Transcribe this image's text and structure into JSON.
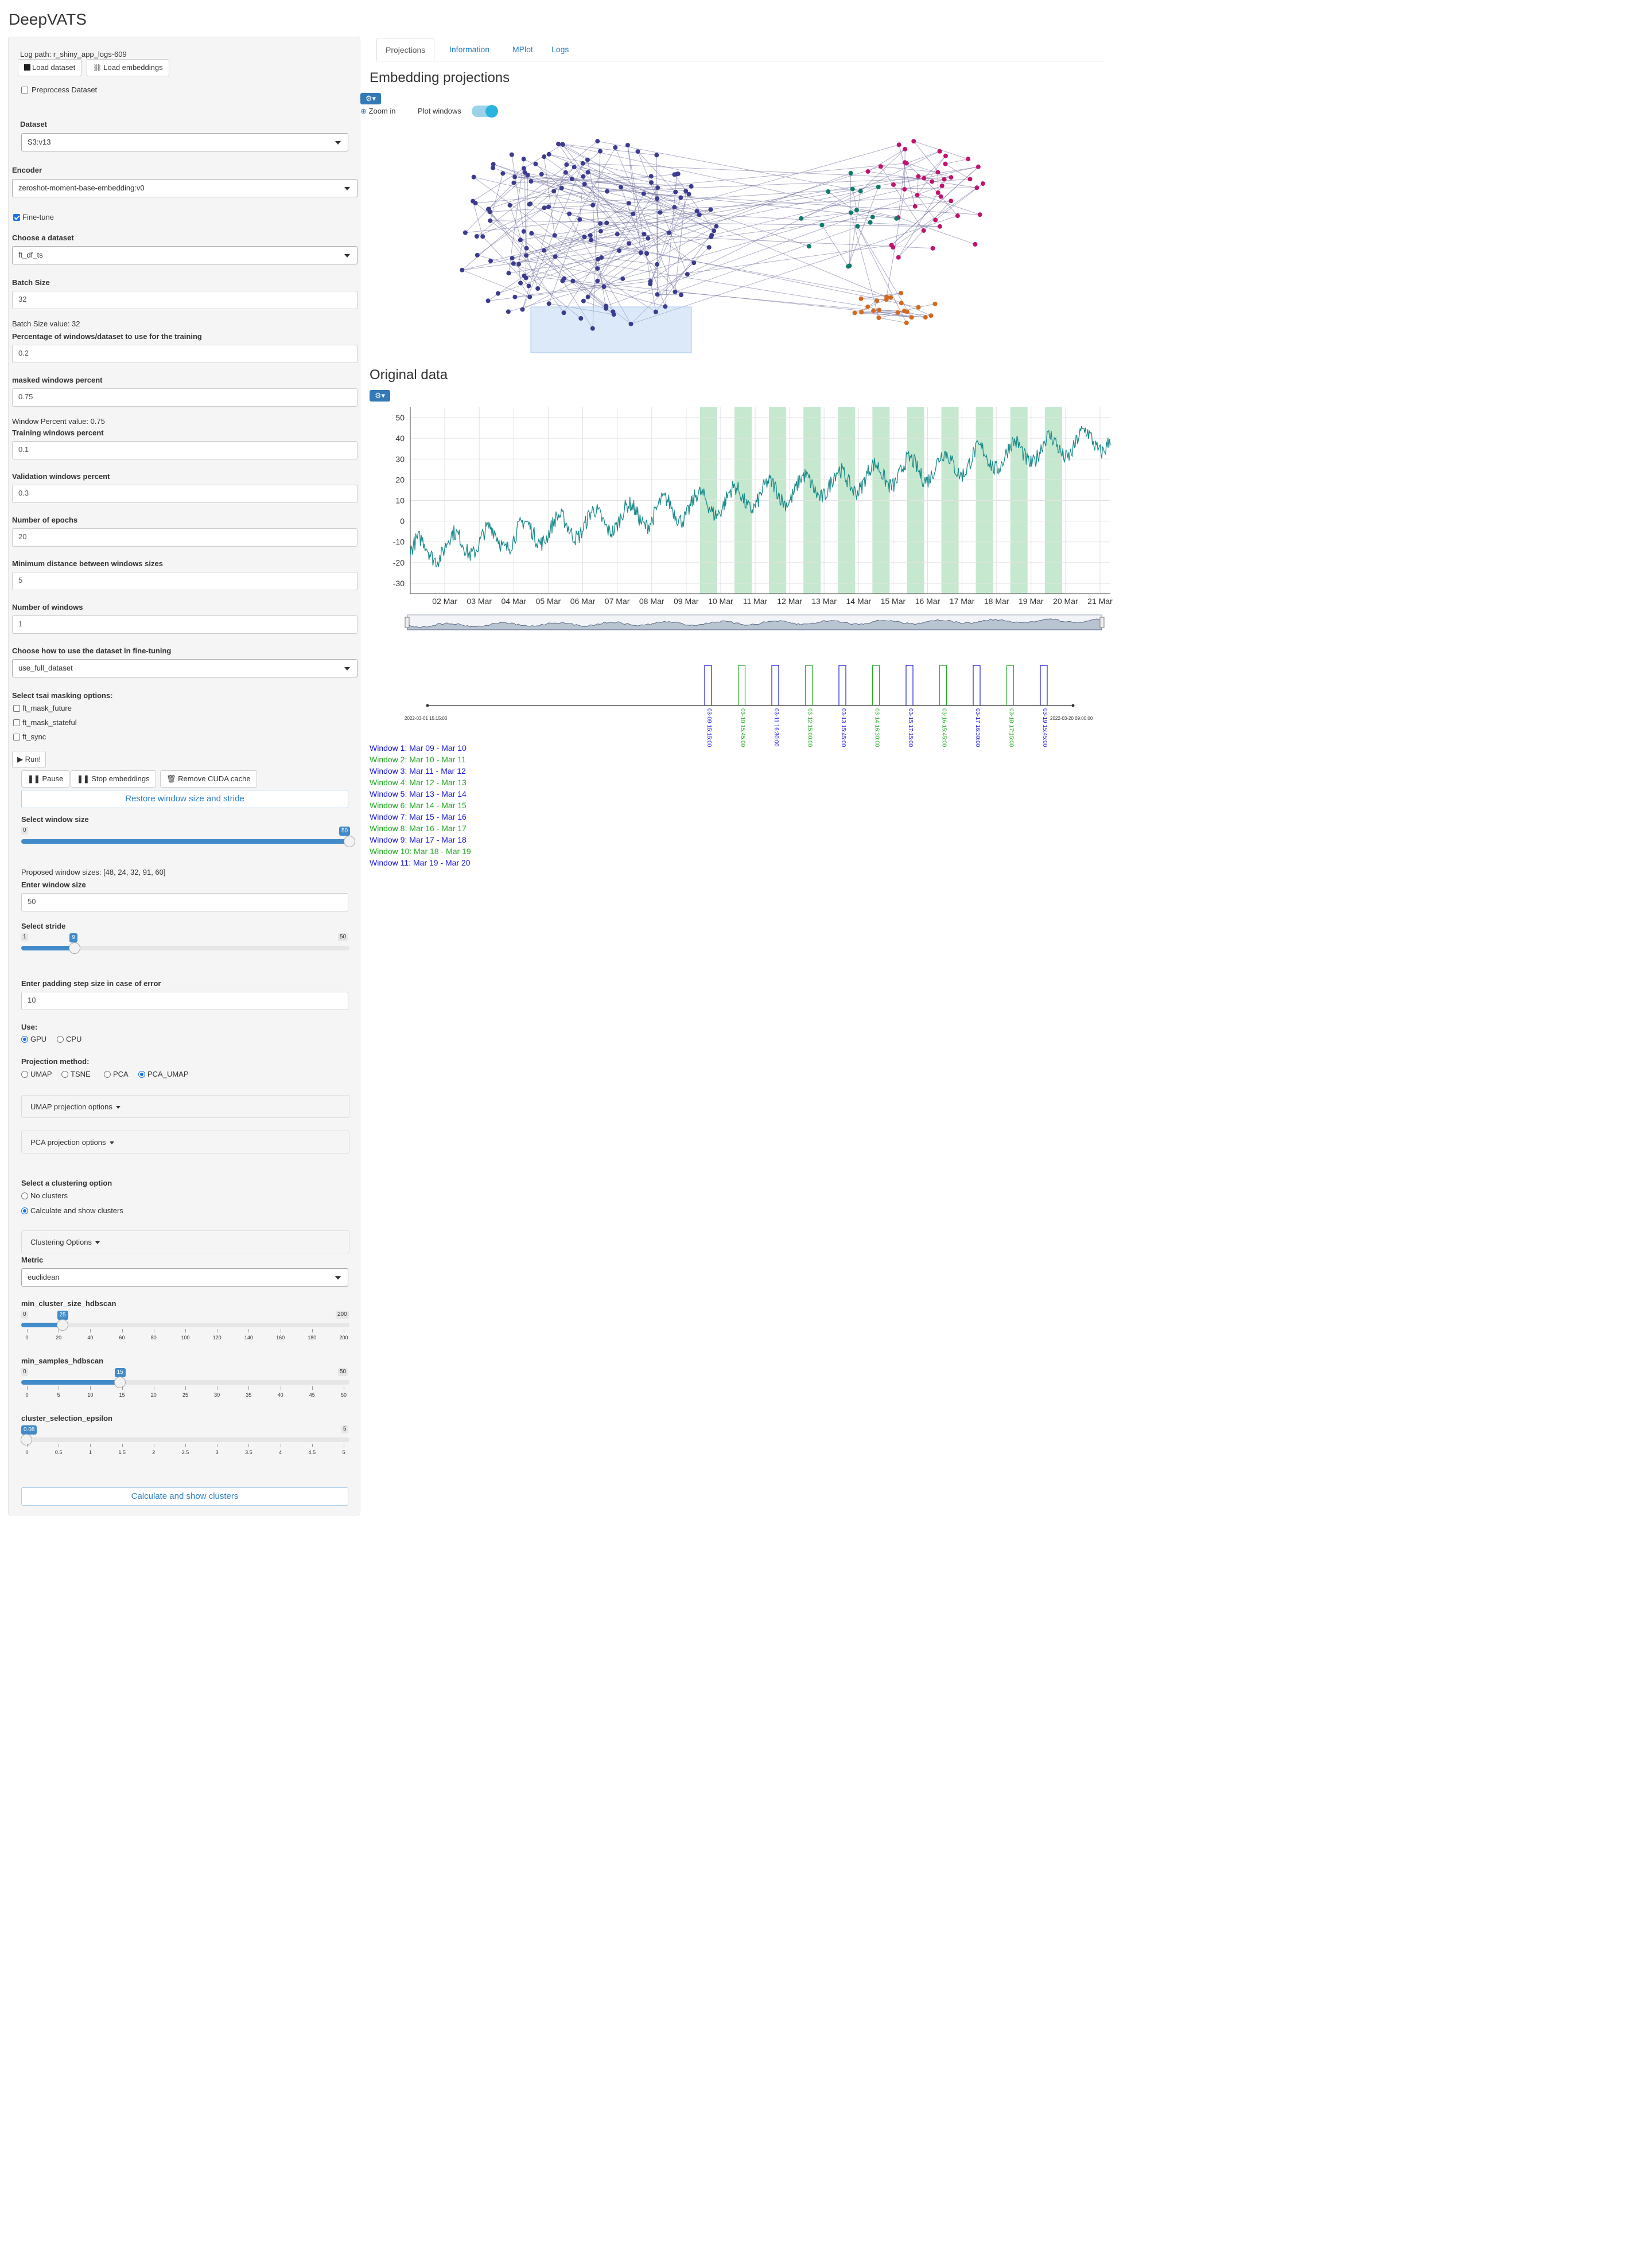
{
  "app": {
    "title": "DeepVATS"
  },
  "sidebar": {
    "log_path": "Log path: r_shiny_app_logs-609",
    "load_dataset": "Load dataset",
    "load_embeddings": "Load embeddings",
    "preprocess": "Preprocess Dataset",
    "dataset_label": "Dataset",
    "dataset_value": "S3:v13",
    "encoder_label": "Encoder",
    "encoder_value": "zeroshot-moment-base-embedding:v0",
    "finetune": "Fine-tune",
    "choose_dataset_label": "Choose a dataset",
    "choose_dataset_value": "ft_df_ts",
    "batch_size_label": "Batch Size",
    "batch_size_value": "32",
    "batch_size_info": "Batch Size value: 32",
    "pct_windows_label": "Percentage of windows/dataset to use for the training",
    "pct_windows_value": "0.2",
    "masked_label": "masked windows percent",
    "masked_value": "0.75",
    "window_pct_info": "Window Percent value: 0.75",
    "training_label": "Training windows percent",
    "training_value": "0.1",
    "validation_label": "Validation windows percent",
    "validation_value": "0.3",
    "epochs_label": "Number of epochs",
    "epochs_value": "20",
    "min_dist_label": "Minimum distance between windows sizes",
    "min_dist_value": "5",
    "num_windows_label": "Number of windows",
    "num_windows_value": "1",
    "how_use_label": "Choose how to use the dataset in fine-tuning",
    "how_use_value": "use_full_dataset",
    "masking_label": "Select tsai masking options:",
    "mask_options": [
      "ft_mask_future",
      "ft_mask_stateful",
      "ft_sync"
    ],
    "run": "Run!",
    "pause": "Pause",
    "stop_embeddings": "Stop embeddings",
    "remove_cuda": "Remove CUDA cache",
    "restore": "Restore window size and stride",
    "window_size_label": "Select window size",
    "window_size": {
      "min": "0",
      "max": "50",
      "value": 50,
      "badge": "50"
    },
    "proposed": "Proposed window sizes: [48, 24, 32, 91, 60]",
    "enter_window_label": "Enter window size",
    "enter_window_value": "50",
    "stride_label": "Select stride",
    "stride": {
      "min": "1",
      "max": "50",
      "value": 9,
      "badge": "9"
    },
    "padding_label": "Enter padding step size in case of error",
    "padding_value": "10",
    "use_label": "Use:",
    "use_options": [
      "GPU",
      "CPU"
    ],
    "proj_label": "Projection method:",
    "proj_options": [
      "UMAP",
      "TSNE",
      "PCA",
      "PCA_UMAP"
    ],
    "umap_opts": "UMAP projection options",
    "pca_opts": "PCA projection options",
    "cluster_label": "Select a clustering option",
    "cluster_options": [
      "No clusters",
      "Calculate and show clusters"
    ],
    "clustering_opts": "Clustering Options",
    "metric_label": "Metric",
    "metric_value": "euclidean",
    "min_cluster_label": "min_cluster_size_hdbscan",
    "min_cluster": {
      "min": "0",
      "max": "200",
      "value": 25,
      "badge": "25",
      "ticks": [
        "0",
        "20",
        "40",
        "60",
        "80",
        "100",
        "120",
        "140",
        "160",
        "180",
        "200"
      ]
    },
    "min_samples_label": "min_samples_hdbscan",
    "min_samples": {
      "min": "0",
      "max": "50",
      "value": 15,
      "badge": "15",
      "ticks": [
        "0",
        "5",
        "10",
        "15",
        "20",
        "25",
        "30",
        "35",
        "40",
        "45",
        "50"
      ]
    },
    "epsilon_label": "cluster_selection_epsilon",
    "epsilon": {
      "min": "0",
      "max": "5",
      "value": 0.08,
      "badge": "0.08",
      "ticks": [
        "0",
        "0.5",
        "1",
        "1.5",
        "2",
        "2.5",
        "3",
        "3.5",
        "4",
        "4.5",
        "5"
      ]
    },
    "calc_button": "Calculate and show clusters"
  },
  "tabs": [
    "Projections",
    "Information",
    "MPlot",
    "Logs"
  ],
  "main": {
    "embedding_title": "Embedding projections",
    "zoom_in": "Zoom in",
    "plot_windows": "Plot windows",
    "original_title": "Original data"
  },
  "colors": {
    "accent": "#337ab7",
    "link": "#2c7fc4",
    "series": "#1a8a8a",
    "window_shade": "#a8dbb5",
    "cluster_purple": "#3b3b8f",
    "cluster_magenta": "#c0136f",
    "cluster_orange": "#d2691e",
    "cluster_teal": "#0f7a6a",
    "window_blue": "#1a1ae0",
    "window_green": "#22aa22"
  },
  "chart_data": [
    {
      "type": "scatter",
      "title": "Embedding projections",
      "clusters": [
        "purple",
        "magenta",
        "orange",
        "teal"
      ],
      "note_points": "points connected by lines in time order"
    },
    {
      "type": "line",
      "title": "Original data",
      "x_ticks": [
        "02 Mar",
        "03 Mar",
        "04 Mar",
        "05 Mar",
        "06 Mar",
        "07 Mar",
        "08 Mar",
        "09 Mar",
        "10 Mar",
        "11 Mar",
        "12 Mar",
        "13 Mar",
        "14 Mar",
        "15 Mar",
        "16 Mar",
        "17 Mar",
        "18 Mar",
        "19 Mar",
        "20 Mar",
        "21 Mar"
      ],
      "y_ticks": [
        "50",
        "40",
        "30",
        "20",
        "10",
        "0",
        "-10",
        "-20",
        "-30"
      ],
      "ylim": [
        -35,
        55
      ],
      "trend": {
        "start_value": -15,
        "end_value": 40
      },
      "highlighted_windows": 11
    }
  ],
  "timeline": {
    "start_label": "2022-03-01 15:15:00",
    "end_label": "2022-03-20 09:00:00",
    "windows": [
      {
        "label": "Window 1: Mar 09 - Mar 10",
        "tick": "03-09 15:15:00",
        "color": "blue"
      },
      {
        "label": "Window 2: Mar 10 - Mar 11",
        "tick": "03-10 15:45:00",
        "color": "green"
      },
      {
        "label": "Window 3: Mar 11 - Mar 12",
        "tick": "03-11 16:30:00",
        "color": "blue"
      },
      {
        "label": "Window 4: Mar 12 - Mar 13",
        "tick": "03-12 15:00:00",
        "color": "green"
      },
      {
        "label": "Window 5: Mar 13 - Mar 14",
        "tick": "03-13 15:45:00",
        "color": "blue"
      },
      {
        "label": "Window 6: Mar 14 - Mar 15",
        "tick": "03-14 16:30:00",
        "color": "green"
      },
      {
        "label": "Window 7: Mar 15 - Mar 16",
        "tick": "03-15 17:15:00",
        "color": "blue"
      },
      {
        "label": "Window 8: Mar 16 - Mar 17",
        "tick": "03-16 15:45:00",
        "color": "green"
      },
      {
        "label": "Window 9: Mar 17 - Mar 18",
        "tick": "03-17 16:30:00",
        "color": "blue"
      },
      {
        "label": "Window 10: Mar 18 - Mar 19",
        "tick": "03-18 17:15:00",
        "color": "green"
      },
      {
        "label": "Window 11: Mar 19 - Mar 20",
        "tick": "03-19 15:45:00",
        "color": "blue"
      }
    ]
  }
}
